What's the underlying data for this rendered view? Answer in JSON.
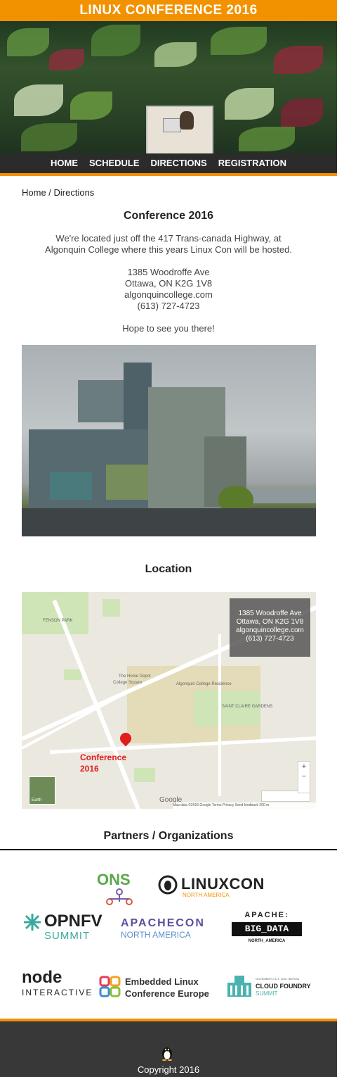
{
  "header": {
    "title": "LINUX CONFERENCE 2016"
  },
  "nav": {
    "items": [
      "HOME",
      "SCHEDULE",
      "DIRECTIONS",
      "REGISTRATION"
    ]
  },
  "breadcrumb": "Home / Directions",
  "intro": {
    "heading": "Conference 2016",
    "line1": "We're located just off the 417 Trans-canada Highway, at",
    "line2": "Algonquin College where this years Linux Con will be hosted.",
    "address": "1385 Woodroffe Ave",
    "city": "Ottawa, ON K2G 1V8",
    "website": "algonquincollege.com",
    "phone": "(613) 727-4723",
    "closing": "Hope to see you there!"
  },
  "location": {
    "heading": "Location",
    "map": {
      "info": [
        "1385 Woodroffe Ave",
        "Ottawa, ON K2G 1V8",
        "algonquincollege.com",
        "(613) 727-4723"
      ],
      "pin_label_line1": "Conference",
      "pin_label_line2": "2016",
      "earth_label": "Earth",
      "google_label": "Google",
      "attribution": "Map data ©2016 Google   Terms   Privacy   Send feedback   200 m"
    }
  },
  "partners": {
    "heading": "Partners / Organizations",
    "logos": {
      "ons": "ONS",
      "linuxcon": "LINUXCON",
      "linuxcon_sub": "NORTH AMERICA",
      "opnfv": "OPNFV",
      "opnfv_sub": "SUMMIT",
      "apachecon": "APACHECON",
      "apachecon_sub": "NORTH AMERICA",
      "bigdata_top": "APACHE:",
      "bigdata_mid": "BIG_DATA",
      "bigdata_sub": "NORTH_AMERICA",
      "node": "node",
      "node_sub": "INTERACTIVE",
      "elce_1": "Embedded Linux",
      "elce_2": "Conference Europe",
      "cf_top": "NOVEMBER 2 & 3, 2016 | BERLIN",
      "cf_1": "CLOUD FOUNDRY",
      "cf_2": "SUMMIT"
    }
  },
  "footer": {
    "copyright": "Copyright 2016"
  },
  "colors": {
    "accent": "#f39200",
    "nav_bg": "#2b2b2b",
    "footer_bg": "#383838",
    "pin": "#e21b1b"
  }
}
